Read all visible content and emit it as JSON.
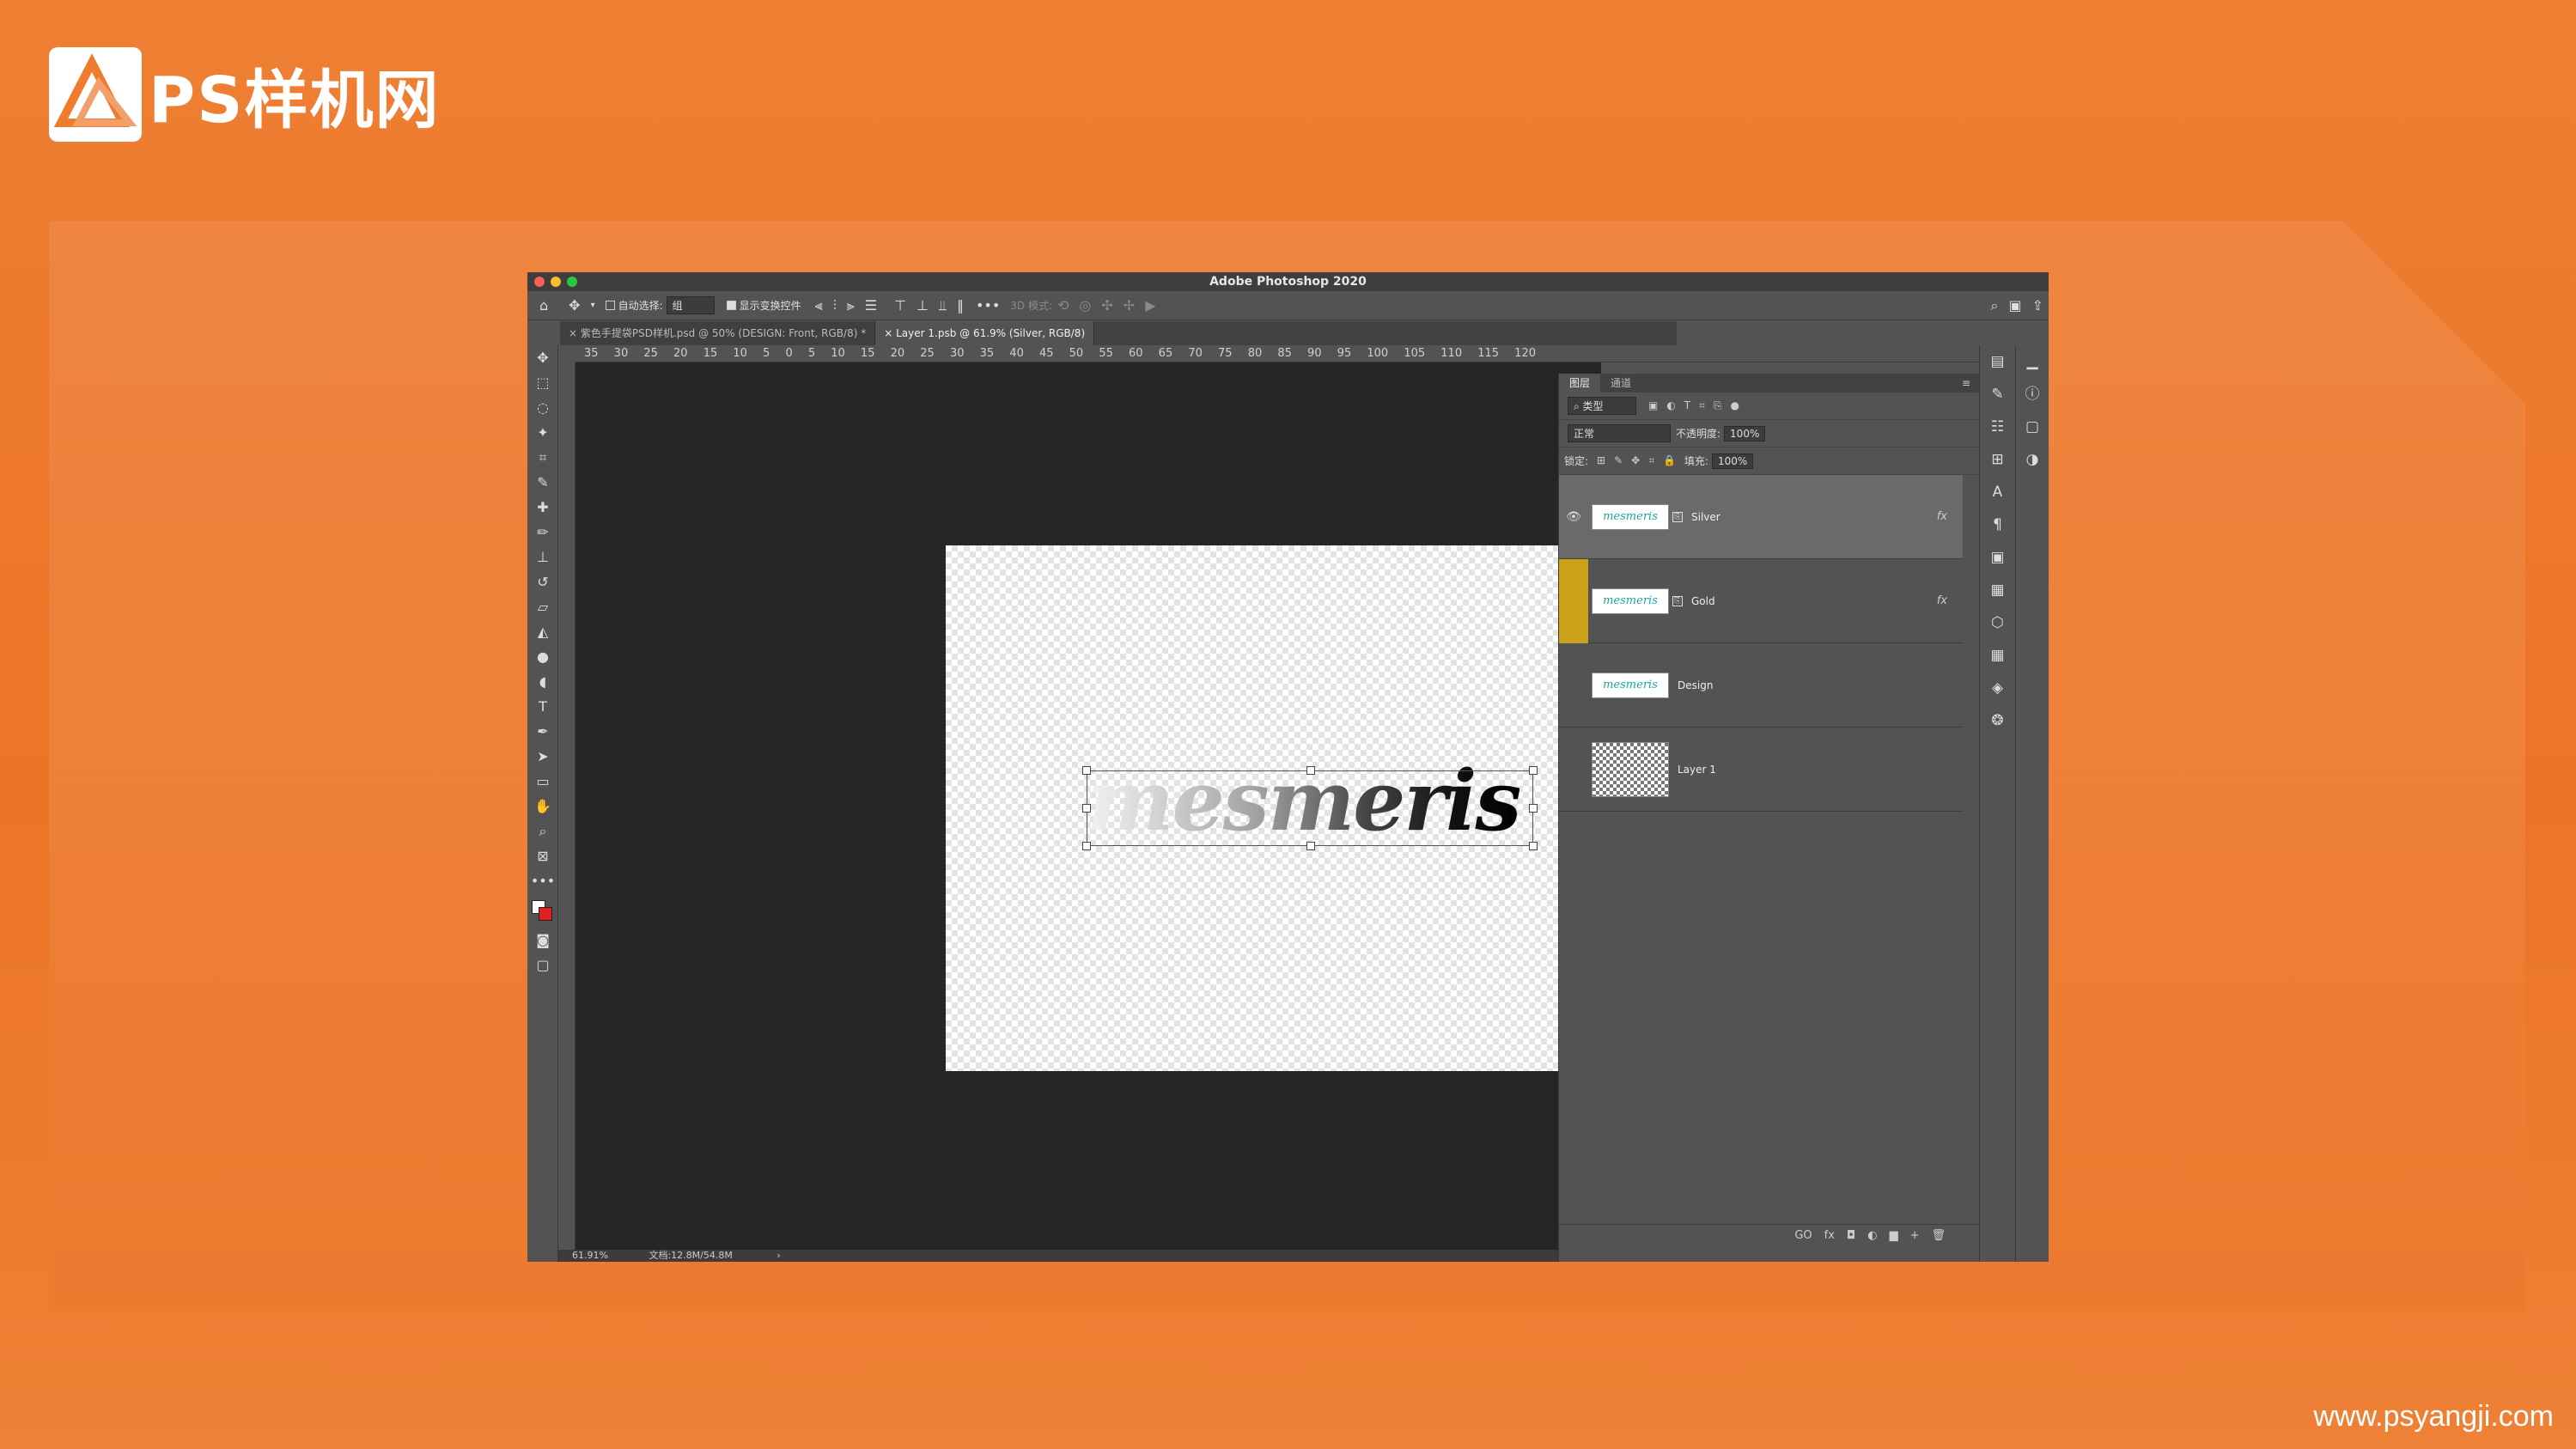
{
  "brand": {
    "name": "PS样机网",
    "url": "www.psyangji.com"
  },
  "app": {
    "title": "Adobe Photoshop 2020"
  },
  "options": {
    "auto_select": "自动选择:",
    "auto_select_value": "组",
    "show_transform": "显示变换控件",
    "mode_3d": "3D 模式:"
  },
  "tabs": [
    {
      "close": "×",
      "label": "紫色手提袋PSD样机.psd @ 50% (DESIGN: Front, RGB/8) *"
    },
    {
      "close": "×",
      "label": "Layer 1.psb @ 61.9% (Silver, RGB/8)"
    }
  ],
  "ruler": {
    "marks": "35  30  25  20  15  10   5   0   5  10  15  20  25  30  35  40  45  50  55  60  65  70  75  80  85  90  95  100 105 110 115 120"
  },
  "canvas": {
    "text": "mesmeris"
  },
  "status": {
    "zoom": "61.91%",
    "doc": "文档:12.8M/54.8M",
    "arrow": "›"
  },
  "layers_panel": {
    "tabs": [
      "图层",
      "通道"
    ],
    "filter": "类型",
    "blend": "正常",
    "opacity_label": "不透明度:",
    "opacity": "100%",
    "lock_label": "锁定:",
    "fill_label": "填充:",
    "fill": "100%",
    "layers": [
      {
        "name": "Silver",
        "thumb": "mesmeris",
        "fx": "fx"
      },
      {
        "name": "Gold",
        "thumb": "mesmeris",
        "fx": "fx"
      },
      {
        "name": "Design",
        "thumb": "mesmeris",
        "fx": ""
      },
      {
        "name": "Layer 1",
        "thumb": "",
        "fx": ""
      }
    ],
    "bottom_icons": [
      "GO",
      "fx",
      "◘",
      "◐",
      "▆",
      "+",
      "🗑"
    ]
  },
  "colors": {
    "orange": "#ee7f33",
    "ps_bg": "#535353",
    "ps_dark": "#262626",
    "gold_layer": "#c9a21a"
  }
}
